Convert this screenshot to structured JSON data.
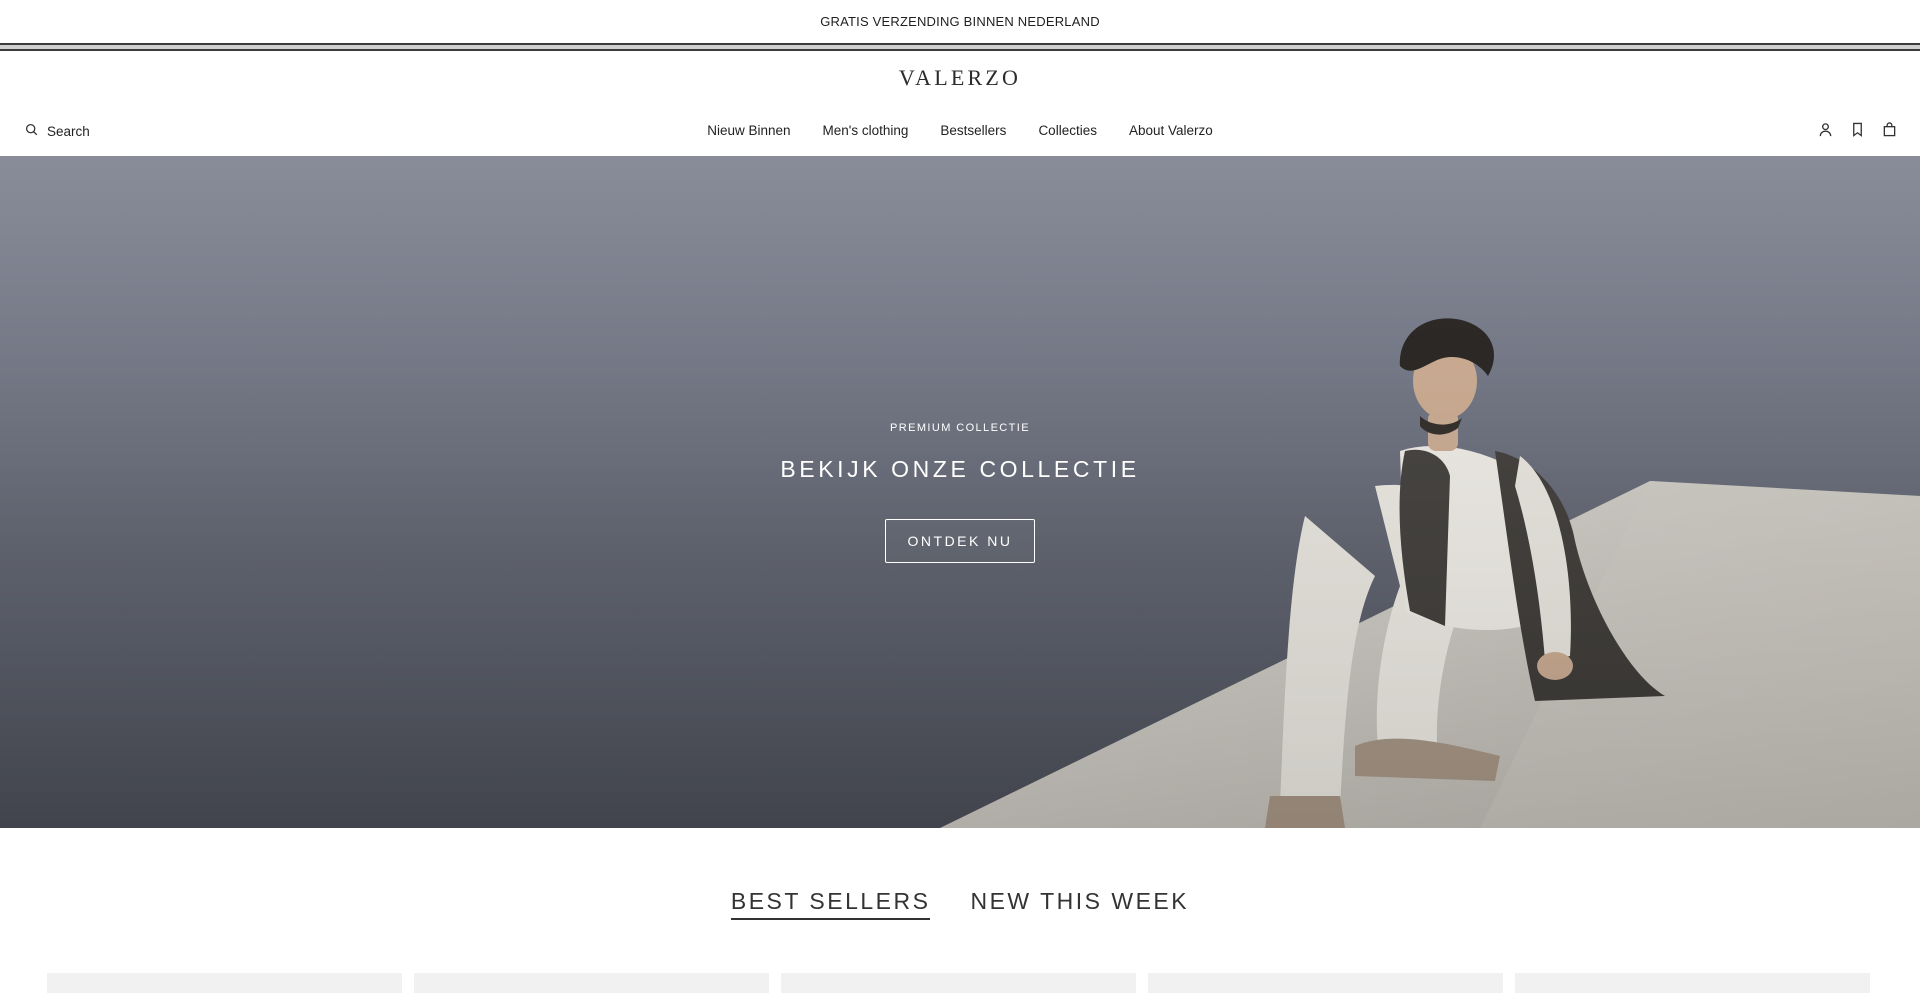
{
  "announcement": "GRATIS VERZENDING BINNEN NEDERLAND",
  "brand": "VALERZO",
  "search": {
    "label": "Search",
    "icon": "search-icon"
  },
  "nav": [
    {
      "label": "Nieuw Binnen"
    },
    {
      "label": "Men's clothing"
    },
    {
      "label": "Bestsellers"
    },
    {
      "label": "Collecties"
    },
    {
      "label": "About Valerzo"
    }
  ],
  "header_icons": [
    "account-icon",
    "wishlist-icon",
    "cart-icon"
  ],
  "hero": {
    "eyebrow": "PREMIUM COLLECTIE",
    "title": "BEKIJK ONZE COLLECTIE",
    "button": "ONTDEK NU"
  },
  "tabs": [
    {
      "label": "BEST SELLERS",
      "active": true
    },
    {
      "label": "NEW THIS WEEK",
      "active": false
    }
  ],
  "colors": {
    "text": "#222222",
    "sky_top": "#7f8290",
    "sky_bottom": "#4a4d57",
    "wall": "#d8d4ce"
  }
}
